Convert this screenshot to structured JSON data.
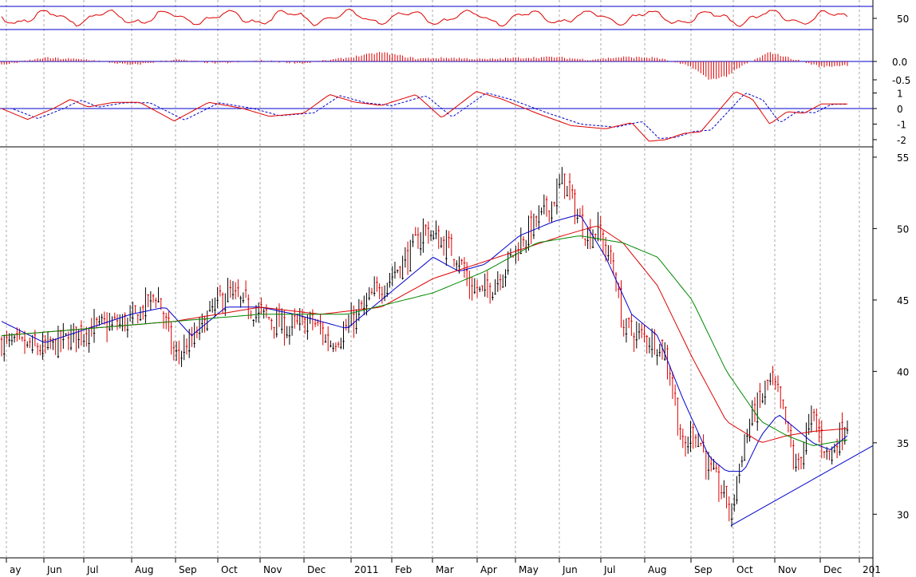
{
  "chart_data": {
    "type": "candlestick",
    "grid": "vertical dotted at month starts",
    "x_months": [
      "ay",
      "Jun",
      "Jul",
      "Aug",
      "Sep",
      "Oct",
      "Nov",
      "Dec",
      "2011",
      "Feb",
      "Mar",
      "Apr",
      "May",
      "Jun",
      "Jul",
      "Aug",
      "Sep",
      "Oct",
      "Nov",
      "Dec",
      "201"
    ],
    "price_panel": {
      "ylim": [
        27,
        56
      ],
      "y_ticks": [
        "55",
        "50",
        "45",
        "40",
        "35",
        "30"
      ],
      "close_anchors": [
        [
          0,
          42
        ],
        [
          5,
          41.5
        ],
        [
          10,
          43
        ],
        [
          15,
          43.5
        ],
        [
          18,
          45.5
        ],
        [
          20,
          41
        ],
        [
          22,
          42
        ],
        [
          24,
          44
        ],
        [
          26,
          45.5
        ],
        [
          30,
          44
        ],
        [
          33,
          43
        ],
        [
          36,
          43.5
        ],
        [
          38,
          42
        ],
        [
          40,
          43
        ],
        [
          44,
          46
        ],
        [
          47,
          48
        ],
        [
          49,
          50
        ],
        [
          51,
          49
        ],
        [
          53,
          48
        ],
        [
          54,
          46
        ],
        [
          56,
          45.5
        ],
        [
          58,
          47
        ],
        [
          60,
          49
        ],
        [
          62,
          50.5
        ],
        [
          64,
          52
        ],
        [
          65,
          53.5
        ],
        [
          66,
          52
        ],
        [
          67,
          50.5
        ],
        [
          68,
          49.5
        ],
        [
          69,
          50
        ],
        [
          70,
          48.5
        ],
        [
          71,
          47
        ],
        [
          72,
          43
        ],
        [
          74,
          42.5
        ],
        [
          76,
          42
        ],
        [
          77,
          41
        ],
        [
          78,
          38
        ],
        [
          79,
          34
        ],
        [
          80,
          36
        ],
        [
          81,
          35
        ],
        [
          82,
          33
        ],
        [
          83,
          32
        ],
        [
          84,
          31
        ],
        [
          84.5,
          29.5
        ],
        [
          85,
          32
        ],
        [
          86,
          35
        ],
        [
          87,
          37
        ],
        [
          88,
          38
        ],
        [
          89,
          39.5
        ],
        [
          90,
          38
        ],
        [
          91,
          36
        ],
        [
          92,
          33
        ],
        [
          93,
          35
        ],
        [
          94,
          37
        ],
        [
          95,
          35
        ],
        [
          96,
          34
        ],
        [
          97,
          35.5
        ],
        [
          98,
          36.5
        ]
      ],
      "ma_fast_anchors": [
        [
          0,
          43.5
        ],
        [
          5,
          42
        ],
        [
          10,
          43
        ],
        [
          15,
          44
        ],
        [
          19,
          44.5
        ],
        [
          22,
          42.5
        ],
        [
          26,
          44.5
        ],
        [
          30,
          44.5
        ],
        [
          34,
          44
        ],
        [
          37,
          43.5
        ],
        [
          40,
          43
        ],
        [
          44,
          45
        ],
        [
          47,
          46.5
        ],
        [
          50,
          48
        ],
        [
          53,
          47
        ],
        [
          56,
          47.5
        ],
        [
          60,
          49.5
        ],
        [
          64,
          50.5
        ],
        [
          67,
          51
        ],
        [
          70,
          48
        ],
        [
          73,
          44
        ],
        [
          76,
          42.5
        ],
        [
          79,
          38
        ],
        [
          82,
          34
        ],
        [
          84,
          33
        ],
        [
          86,
          33
        ],
        [
          88,
          35.5
        ],
        [
          90,
          37
        ],
        [
          92,
          36
        ],
        [
          94,
          35
        ],
        [
          96,
          34.5
        ],
        [
          98,
          35.5
        ]
      ],
      "ma_mid_anchors": [
        [
          0,
          42.5
        ],
        [
          10,
          43
        ],
        [
          20,
          43.5
        ],
        [
          30,
          44.5
        ],
        [
          37,
          44
        ],
        [
          44,
          44.5
        ],
        [
          50,
          46.5
        ],
        [
          55,
          47.5
        ],
        [
          60,
          48.5
        ],
        [
          65,
          49.5
        ],
        [
          69,
          50.2
        ],
        [
          72,
          49
        ],
        [
          76,
          46
        ],
        [
          80,
          41
        ],
        [
          84,
          36.5
        ],
        [
          88,
          35
        ],
        [
          91,
          35.5
        ],
        [
          94,
          35.8
        ],
        [
          98,
          36
        ]
      ],
      "ma_slow_anchors": [
        [
          0,
          42.5
        ],
        [
          10,
          43
        ],
        [
          20,
          43.5
        ],
        [
          30,
          44
        ],
        [
          40,
          44
        ],
        [
          50,
          45.5
        ],
        [
          56,
          47
        ],
        [
          62,
          49
        ],
        [
          67,
          49.5
        ],
        [
          72,
          49
        ],
        [
          76,
          48
        ],
        [
          80,
          45
        ],
        [
          84,
          40
        ],
        [
          88,
          36.5
        ],
        [
          91,
          35.5
        ],
        [
          94,
          34.8
        ],
        [
          98,
          35.2
        ]
      ],
      "trendline": [
        [
          84.5,
          29.2
        ],
        [
          100,
          34.8
        ]
      ]
    },
    "oscillator_1": {
      "y_ticks": [
        "50"
      ],
      "upper_line_value": 1.0,
      "lower_line_value": 0.0
    },
    "oscillator_2": {
      "y_ticks": [
        "0.0",
        "-0.5"
      ],
      "baseline": 0.0,
      "ylim": [
        -0.7,
        0.3
      ],
      "histogram_anchors": [
        [
          0,
          -0.1
        ],
        [
          5,
          0.1
        ],
        [
          10,
          0.05
        ],
        [
          15,
          -0.1
        ],
        [
          20,
          0.05
        ],
        [
          25,
          -0.05
        ],
        [
          30,
          0.02
        ],
        [
          35,
          -0.05
        ],
        [
          40,
          0.1
        ],
        [
          44,
          0.25
        ],
        [
          48,
          0.08
        ],
        [
          52,
          0.1
        ],
        [
          56,
          0.06
        ],
        [
          60,
          0.1
        ],
        [
          64,
          0.12
        ],
        [
          68,
          0.05
        ],
        [
          72,
          0.12
        ],
        [
          76,
          0.1
        ],
        [
          80,
          -0.15
        ],
        [
          82,
          -0.5
        ],
        [
          84,
          -0.4
        ],
        [
          86,
          -0.1
        ],
        [
          89,
          0.25
        ],
        [
          92,
          0.05
        ],
        [
          95,
          -0.15
        ],
        [
          98,
          -0.1
        ]
      ]
    },
    "oscillator_3": {
      "y_ticks": [
        "1",
        "0",
        "-1",
        "-2"
      ],
      "ylim": [
        -2.5,
        1.2
      ],
      "zero_line_value": 0.0,
      "solid_anchors": [
        [
          0,
          0
        ],
        [
          3,
          -0.7
        ],
        [
          6,
          0
        ],
        [
          8,
          0.6
        ],
        [
          10,
          0.1
        ],
        [
          13,
          0.4
        ],
        [
          16,
          0.4
        ],
        [
          20,
          -0.8
        ],
        [
          24,
          0.4
        ],
        [
          28,
          0
        ],
        [
          31,
          -0.5
        ],
        [
          35,
          -0.3
        ],
        [
          38,
          0.9
        ],
        [
          41,
          0.4
        ],
        [
          44,
          0.2
        ],
        [
          48,
          0.9
        ],
        [
          51,
          -0.6
        ],
        [
          55,
          1.1
        ],
        [
          58,
          0.6
        ],
        [
          62,
          -0.3
        ],
        [
          66,
          -1.1
        ],
        [
          70,
          -1.3
        ],
        [
          73,
          -0.9
        ],
        [
          75,
          -2.1
        ],
        [
          77,
          -2.0
        ],
        [
          79,
          -1.6
        ],
        [
          81,
          -1.5
        ],
        [
          83,
          -0.2
        ],
        [
          85,
          1.1
        ],
        [
          87,
          0.6
        ],
        [
          89,
          -1.0
        ],
        [
          91,
          -0.2
        ],
        [
          93,
          -0.3
        ],
        [
          95,
          0.3
        ]
      ]
    }
  }
}
